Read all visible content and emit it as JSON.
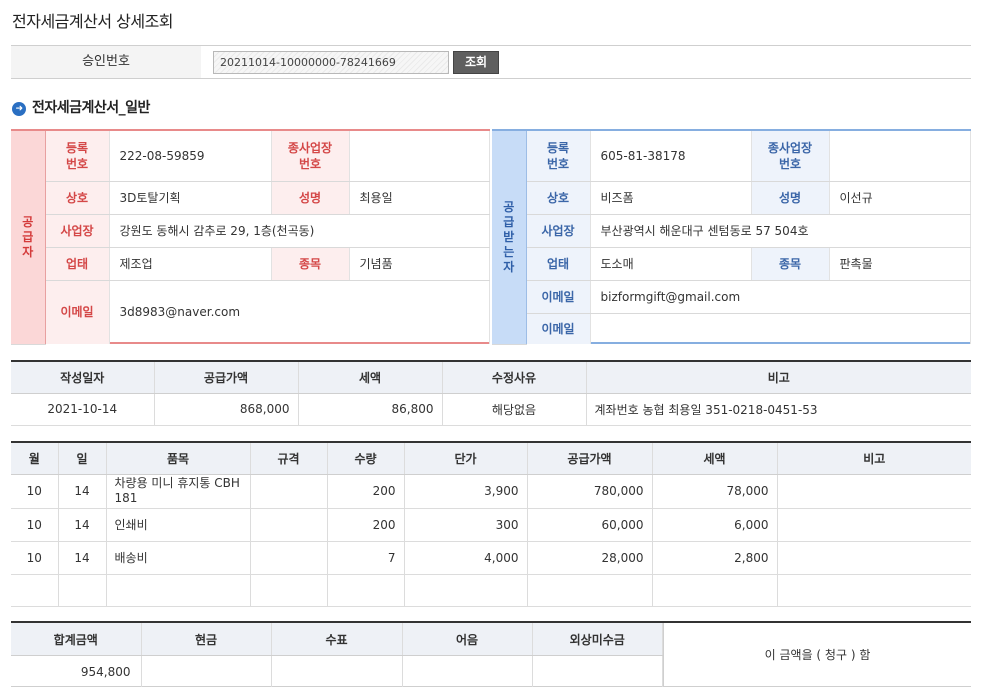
{
  "page": {
    "title": "전자세금계산서 상세조회"
  },
  "approval": {
    "label": "승인번호",
    "value": "20211014-10000000-78241669",
    "button": "조회"
  },
  "section": {
    "title": "전자세금계산서_일반",
    "bullet": "➜"
  },
  "supplier": {
    "side_label": "공급자",
    "reg_label": "등록번호",
    "reg_no": "222-08-59859",
    "branch_label": "종사업장번호",
    "branch_no": "",
    "name_label": "상호",
    "name": "3D토탈기획",
    "rep_label": "성명",
    "rep": "최용일",
    "addr_label": "사업장",
    "addr": "강원도 동해시 감추로 29, 1층(천곡동)",
    "biz_label": "업태",
    "biz": "제조업",
    "item_label": "종목",
    "item": "기념품",
    "email_label": "이메일",
    "email": "3d8983@naver.com"
  },
  "buyer": {
    "side_label": "공급받는자",
    "reg_label": "등록번호",
    "reg_no": "605-81-38178",
    "branch_label": "종사업장번호",
    "branch_no": "",
    "name_label": "상호",
    "name": "비즈폼",
    "rep_label": "성명",
    "rep": "이선규",
    "addr_label": "사업장",
    "addr": "부산광역시 해운대구 센텀동로 57 504호",
    "biz_label": "업태",
    "biz": "도소매",
    "item_label": "종목",
    "item": "판촉물",
    "email_label": "이메일",
    "email": "bizformgift@gmail.com",
    "email2_label": "이메일",
    "email2": ""
  },
  "invoice_info": {
    "headers": [
      "작성일자",
      "공급가액",
      "세액",
      "수정사유",
      "비고"
    ],
    "row": {
      "date": "2021-10-14",
      "supply": "868,000",
      "tax": "86,800",
      "reason": "해당없음",
      "note": "계좌번호 농협 최용일 351-0218-0451-53"
    }
  },
  "items": {
    "headers": [
      "월",
      "일",
      "품목",
      "규격",
      "수량",
      "단가",
      "공급가액",
      "세액",
      "비고"
    ],
    "rows": [
      {
        "month": "10",
        "day": "14",
        "name": "차량용 미니 휴지통 CBH181",
        "spec": "",
        "qty": "200",
        "unit": "3,900",
        "supply": "780,000",
        "tax": "78,000",
        "note": ""
      },
      {
        "month": "10",
        "day": "14",
        "name": "인쇄비",
        "spec": "",
        "qty": "200",
        "unit": "300",
        "supply": "60,000",
        "tax": "6,000",
        "note": ""
      },
      {
        "month": "10",
        "day": "14",
        "name": "배송비",
        "spec": "",
        "qty": "7",
        "unit": "4,000",
        "supply": "28,000",
        "tax": "2,800",
        "note": ""
      }
    ]
  },
  "summary": {
    "headers": [
      "합계금액",
      "현금",
      "수표",
      "어음",
      "외상미수금"
    ],
    "total": "954,800",
    "cash": "",
    "check": "",
    "note_bill": "",
    "credit": "",
    "claim_text": "이 금액을 ( 청구 ) 함"
  }
}
